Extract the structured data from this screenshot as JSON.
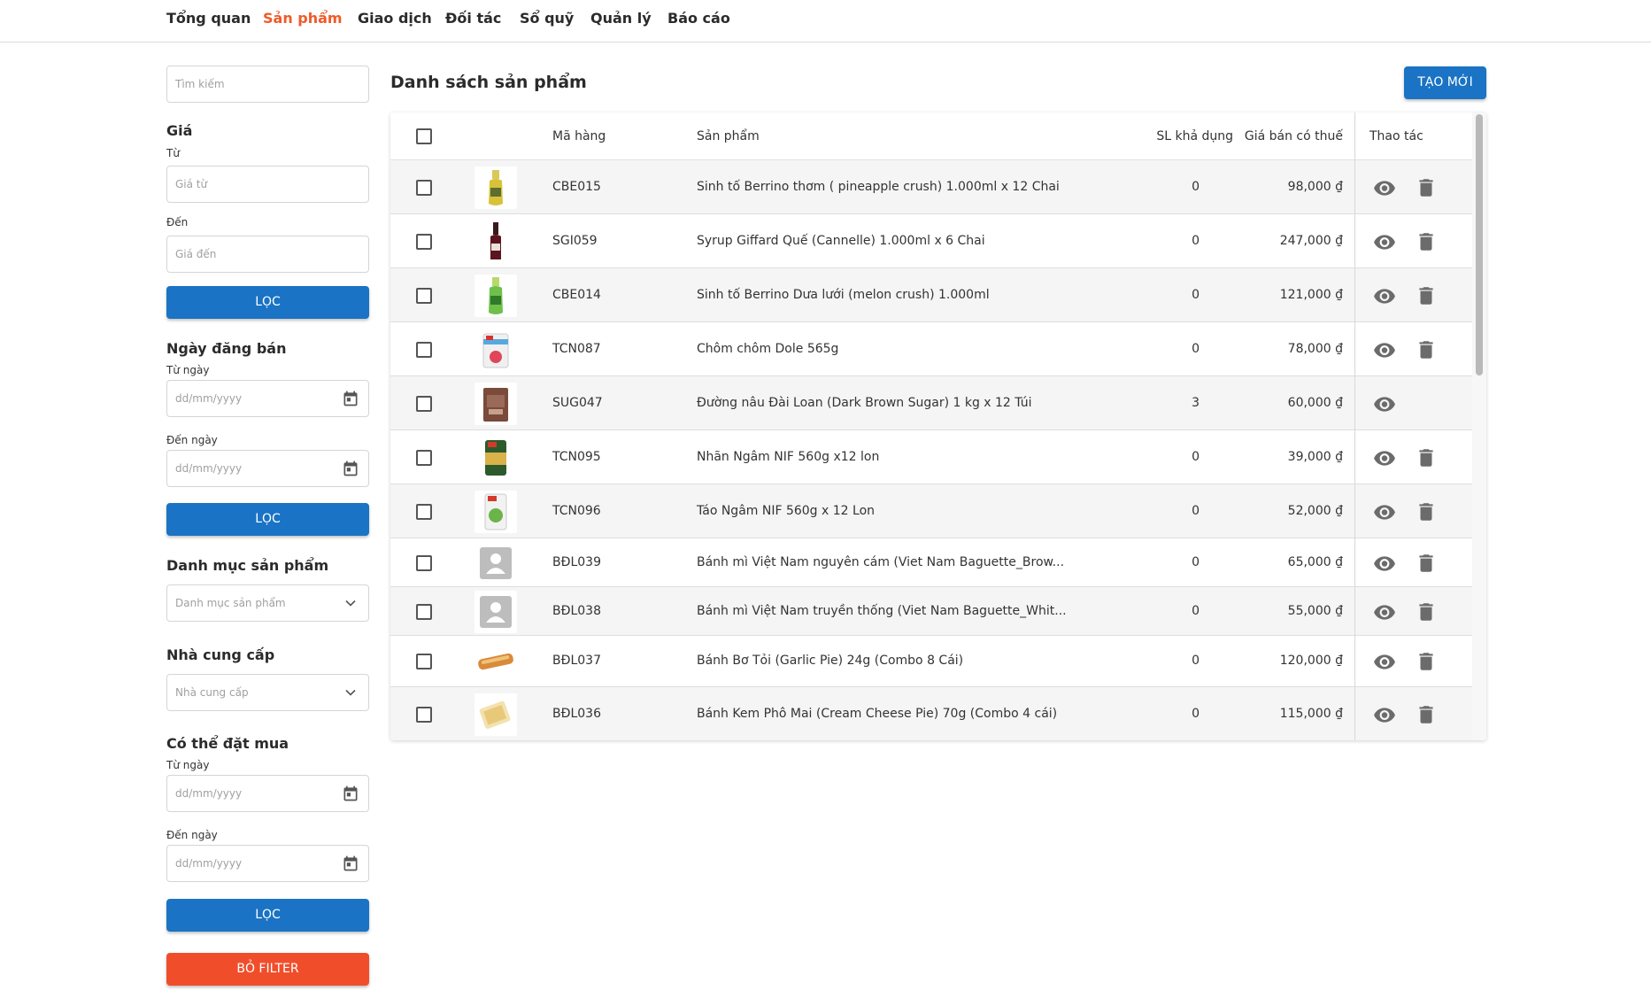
{
  "nav": {
    "items": [
      "Tổng quan",
      "Sản phẩm",
      "Giao dịch",
      "Đối tác",
      "Sổ quỹ",
      "Quản lý",
      "Báo cáo"
    ],
    "active": "Sản phẩm",
    "active_color": "#f05a28"
  },
  "sidebar": {
    "search_placeholder": "Tìm kiếm",
    "price": {
      "title": "Giá",
      "from_label": "Từ",
      "from_placeholder": "Giá từ",
      "to_label": "Đến",
      "to_placeholder": "Giá đến",
      "filter_button": "LỌC"
    },
    "sale_date": {
      "title": "Ngày đăng bán",
      "from_label": "Từ ngày",
      "from_placeholder": "dd/mm/yyyy",
      "to_label": "Đến ngày",
      "to_placeholder": "dd/mm/yyyy",
      "filter_button": "LỌC"
    },
    "category": {
      "title": "Danh mục sản phẩm",
      "placeholder": "Danh mục sản phẩm"
    },
    "supplier": {
      "title": "Nhà cung cấp",
      "placeholder": "Nhà cung cấp"
    },
    "orderable": {
      "title": "Có thể đặt mua",
      "from_label": "Từ ngày",
      "from_placeholder": "dd/mm/yyyy",
      "to_label": "Đến ngày",
      "to_placeholder": "dd/mm/yyyy",
      "filter_button": "LỌC"
    },
    "clear_filter_button": "BỎ FILTER"
  },
  "main": {
    "title": "Danh sách sản phẩm",
    "create_button": "TẠO MỚI",
    "table": {
      "columns": {
        "code": "Mã hàng",
        "product": "Sản phẩm",
        "available_qty": "SL khả dụng",
        "price_incl_tax": "Giá bán có thuế",
        "actions": "Thao tác"
      },
      "rows": [
        {
          "code": "CBE015",
          "name": "Sinh tố Berrino thơm ( pineapple crush) 1.000ml x 12 Chai",
          "qty": "0",
          "price": "98,000 ₫",
          "thumb": "bottle-yellow",
          "deletable": true
        },
        {
          "code": "SGI059",
          "name": "Syrup Giffard Quế (Cannelle) 1.000ml x 6 Chai",
          "qty": "0",
          "price": "247,000 ₫",
          "thumb": "bottle-red",
          "deletable": true
        },
        {
          "code": "CBE014",
          "name": "Sinh tố Berrino Dưa lưới (melon crush) 1.000ml",
          "qty": "0",
          "price": "121,000 ₫",
          "thumb": "bottle-green",
          "deletable": true
        },
        {
          "code": "TCN087",
          "name": "Chôm chôm Dole 565g",
          "qty": "0",
          "price": "78,000 ₫",
          "thumb": "can-white",
          "deletable": true
        },
        {
          "code": "SUG047",
          "name": "Đường nâu Đài Loan (Dark Brown Sugar) 1 kg x 12 Túi",
          "qty": "3",
          "price": "60,000 ₫",
          "thumb": "bag-brown",
          "deletable": false
        },
        {
          "code": "TCN095",
          "name": "Nhãn Ngâm NIF 560g x12 lon",
          "qty": "0",
          "price": "39,000 ₫",
          "thumb": "can-green",
          "deletable": true
        },
        {
          "code": "TCN096",
          "name": "Táo Ngâm NIF 560g x 12 Lon",
          "qty": "0",
          "price": "52,000 ₫",
          "thumb": "can-apple",
          "deletable": true
        },
        {
          "code": "BĐL039",
          "name": "Bánh mì Việt Nam nguyên cám (Viet Nam Baguette_Brow...",
          "qty": "0",
          "price": "65,000 ₫",
          "thumb": "placeholder",
          "deletable": true
        },
        {
          "code": "BĐL038",
          "name": "Bánh mì Việt Nam truyền thống (Viet Nam Baguette_Whit...",
          "qty": "0",
          "price": "55,000 ₫",
          "thumb": "placeholder",
          "deletable": true
        },
        {
          "code": "BĐL037",
          "name": "Bánh Bơ Tỏi (Garlic Pie) 24g (Combo 8 Cái)",
          "qty": "0",
          "price": "120,000 ₫",
          "thumb": "bread-long",
          "deletable": true
        },
        {
          "code": "BĐL036",
          "name": "Bánh Kem Phô Mai (Cream Cheese Pie) 70g (Combo 4 cái)",
          "qty": "0",
          "price": "115,000 ₫",
          "thumb": "pie-cheese",
          "deletable": true
        }
      ]
    }
  },
  "colors": {
    "primary_button": "#1a73c4",
    "danger_button": "#f04e2b",
    "row_shade": "#f5f5f5"
  },
  "icons": {
    "calendar": "calendar-icon",
    "dropdown": "chevron-down-icon",
    "view": "eye-icon",
    "delete": "trash-icon",
    "checkbox": "checkbox-icon"
  }
}
